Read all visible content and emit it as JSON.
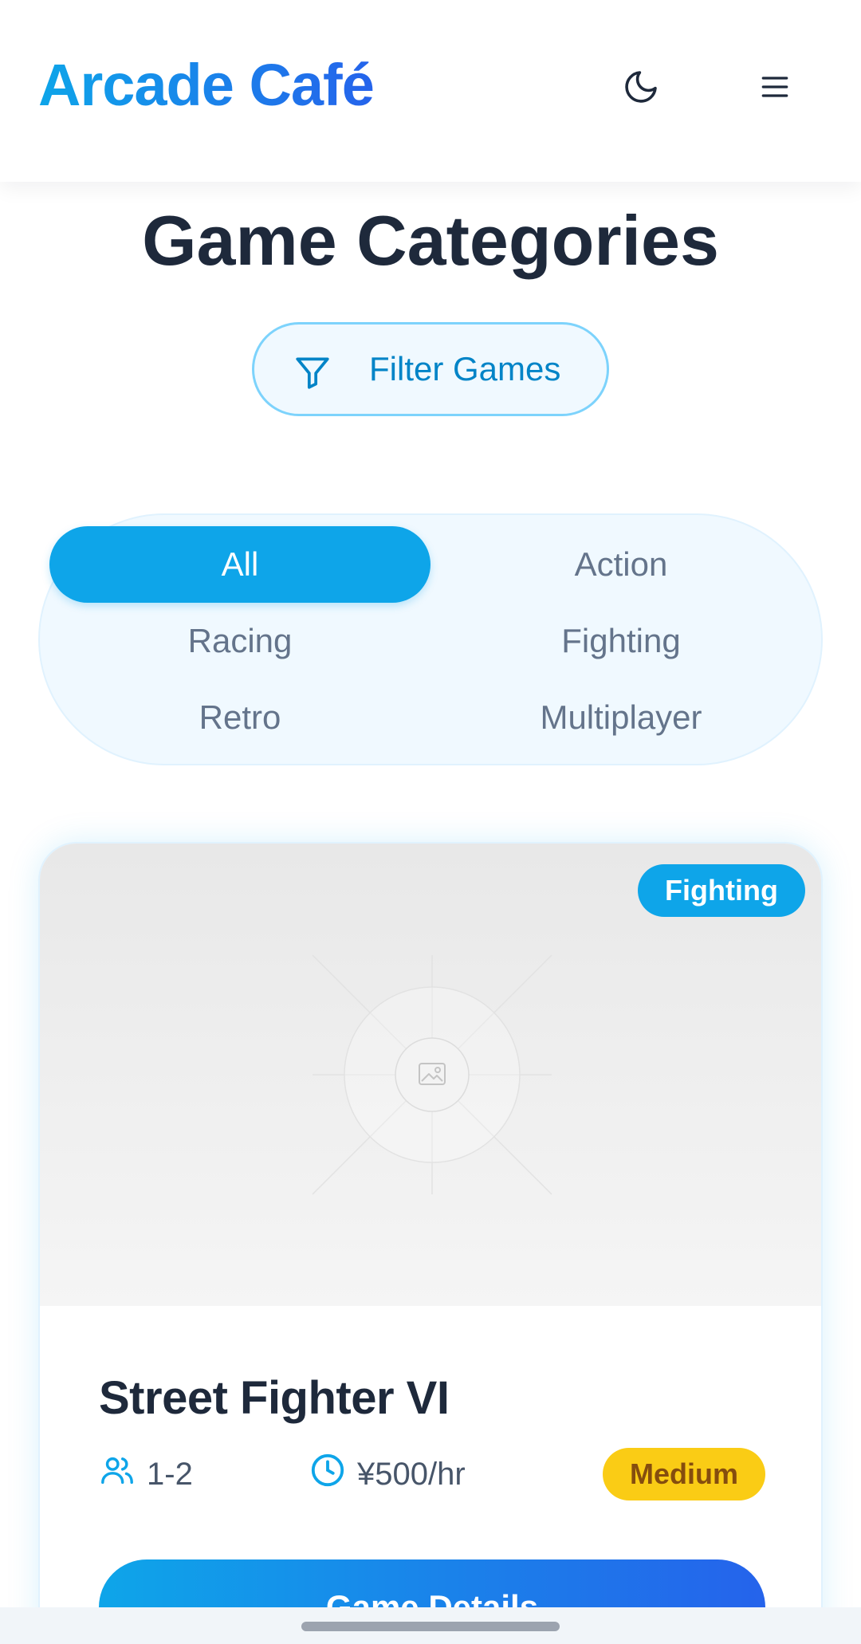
{
  "header": {
    "logo": "Arcade Café",
    "theme_toggle_icon": "moon-icon",
    "menu_icon": "hamburger-menu-icon"
  },
  "page": {
    "title": "Game Categories"
  },
  "filter": {
    "label": "Filter Games",
    "icon": "funnel-icon"
  },
  "categories": {
    "active": "All",
    "items": [
      "All",
      "Action",
      "Racing",
      "Fighting",
      "Retro",
      "Multiplayer"
    ]
  },
  "game_card": {
    "genre": "Fighting",
    "title": "Street Fighter VI",
    "players": "1-2",
    "price": "¥500/hr",
    "difficulty": "Medium",
    "button_label": "Game Details",
    "image_icon": "image-placeholder-icon"
  },
  "colors": {
    "primary": "#0ea5e9",
    "primary_end": "#2563eb",
    "text_dark": "#1e293b",
    "text_muted": "#64748b",
    "difficulty_bg": "#facc15",
    "difficulty_text": "#854d0e"
  }
}
